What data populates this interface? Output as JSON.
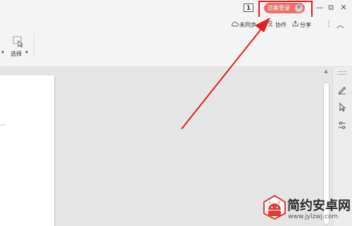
{
  "titlebar": {
    "badge": "1",
    "login_label": "访客登录",
    "minimize": "—",
    "restore": "⧉",
    "close": "✕"
  },
  "toolbar": {
    "unsynced": "未同步",
    "collaborate": "协作",
    "share": "分享",
    "select_label": "选择",
    "more": "⋮",
    "collapse": "︿"
  },
  "icons": {
    "unsynced": "cloud-icon",
    "collaborate": "collaborate-icon",
    "share": "share-icon",
    "select": "select-cursor-icon",
    "pen": "pen-icon",
    "pointer": "pointer-icon",
    "settings": "sliders-icon"
  },
  "colors": {
    "accent": "#e8726b",
    "highlight": "#e02020",
    "logo": "#e53935"
  },
  "watermark": {
    "title": "简约安卓网",
    "url": "www.jylzwj.com"
  }
}
